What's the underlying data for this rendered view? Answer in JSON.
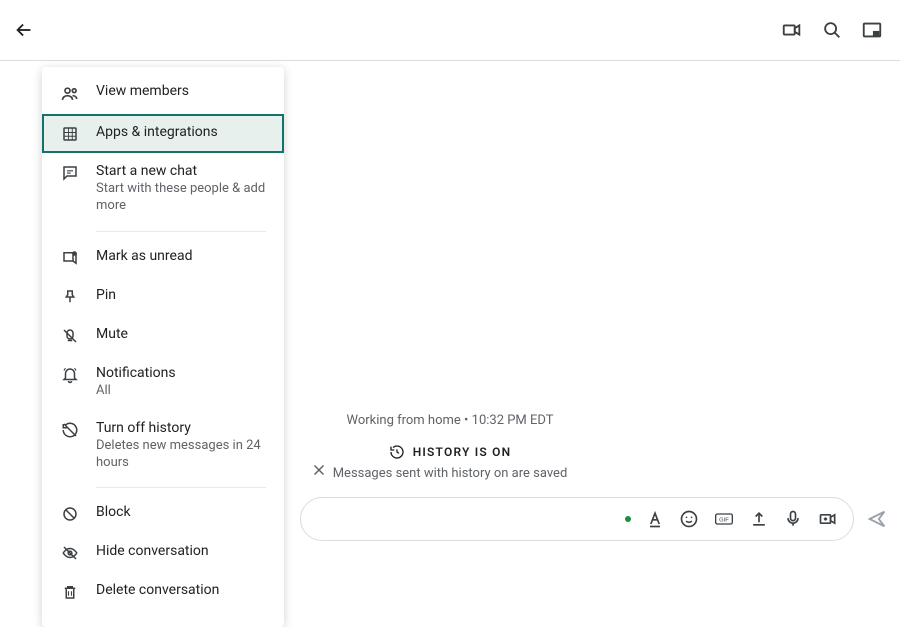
{
  "topbar": {
    "back_label": "Back",
    "video_label": "Video call",
    "search_label": "Search",
    "panel_label": "Side panel"
  },
  "menu": {
    "items": [
      {
        "id": "view-members",
        "label": "View members",
        "icon": "people-icon",
        "sub": null
      },
      {
        "id": "apps-integrations",
        "label": "Apps & integrations",
        "icon": "apps-icon",
        "sub": null,
        "highlight": true
      },
      {
        "id": "start-chat",
        "label": "Start a new chat",
        "icon": "chat-icon",
        "sub": "Start with these people & add more"
      },
      {
        "divider": true
      },
      {
        "id": "mark-unread",
        "label": "Mark as unread",
        "icon": "unread-icon",
        "sub": null
      },
      {
        "id": "pin",
        "label": "Pin",
        "icon": "pin-icon",
        "sub": null
      },
      {
        "id": "mute",
        "label": "Mute",
        "icon": "mute-icon",
        "sub": null
      },
      {
        "id": "notifications",
        "label": "Notifications",
        "icon": "bell-icon",
        "sub": "All"
      },
      {
        "id": "turn-off-history",
        "label": "Turn off history",
        "icon": "history-off-icon",
        "sub": "Deletes new messages in 24 hours"
      },
      {
        "divider": true
      },
      {
        "id": "block",
        "label": "Block",
        "icon": "block-icon",
        "sub": null
      },
      {
        "id": "hide",
        "label": "Hide conversation",
        "icon": "hide-icon",
        "sub": null
      },
      {
        "id": "delete",
        "label": "Delete conversation",
        "icon": "delete-icon",
        "sub": null
      }
    ]
  },
  "status": {
    "line": "Working from home • 10:32 PM EDT"
  },
  "history": {
    "title": "HISTORY IS ON",
    "sub": "Messages sent with history on are saved"
  },
  "compose": {
    "close_label": "Close",
    "format_label": "Formatting",
    "emoji_label": "Emoji",
    "gif_label": "GIF",
    "upload_label": "Upload file",
    "mic_label": "Voice",
    "meet_label": "Add video meeting",
    "send_label": "Send"
  }
}
